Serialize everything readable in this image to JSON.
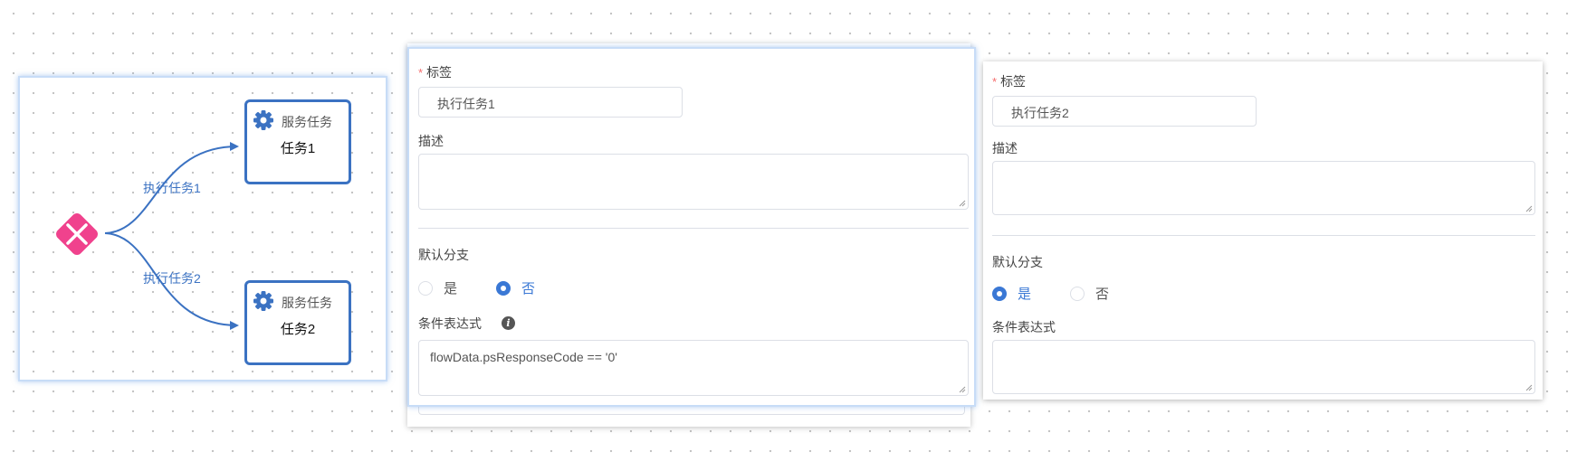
{
  "diagram": {
    "task1": {
      "type_label": "服务任务",
      "name": "任务1"
    },
    "task2": {
      "type_label": "服务任务",
      "name": "任务2"
    },
    "edge1_label": "执行任务1",
    "edge2_label": "执行任务2",
    "colors": {
      "accent": "#3b72c2",
      "gateway": "#f0428d",
      "selection": "#c7dcf7"
    },
    "icons": {
      "task": "gear-icon",
      "gateway": "exclusive-gateway-icon"
    }
  },
  "panel1": {
    "label_title": "标签",
    "label_value": "执行任务1",
    "desc_title": "描述",
    "desc_value": "",
    "default_branch_title": "默认分支",
    "yes": "是",
    "no": "否",
    "selected": "no",
    "condition_title": "条件表达式",
    "condition_value": "flowData.psResponseCode == '0'"
  },
  "panel2": {
    "label_title": "标签",
    "label_value": "执行任务2",
    "desc_title": "描述",
    "desc_value": "",
    "default_branch_title": "默认分支",
    "yes": "是",
    "no": "否",
    "selected": "yes",
    "condition_title": "条件表达式",
    "condition_value": ""
  }
}
